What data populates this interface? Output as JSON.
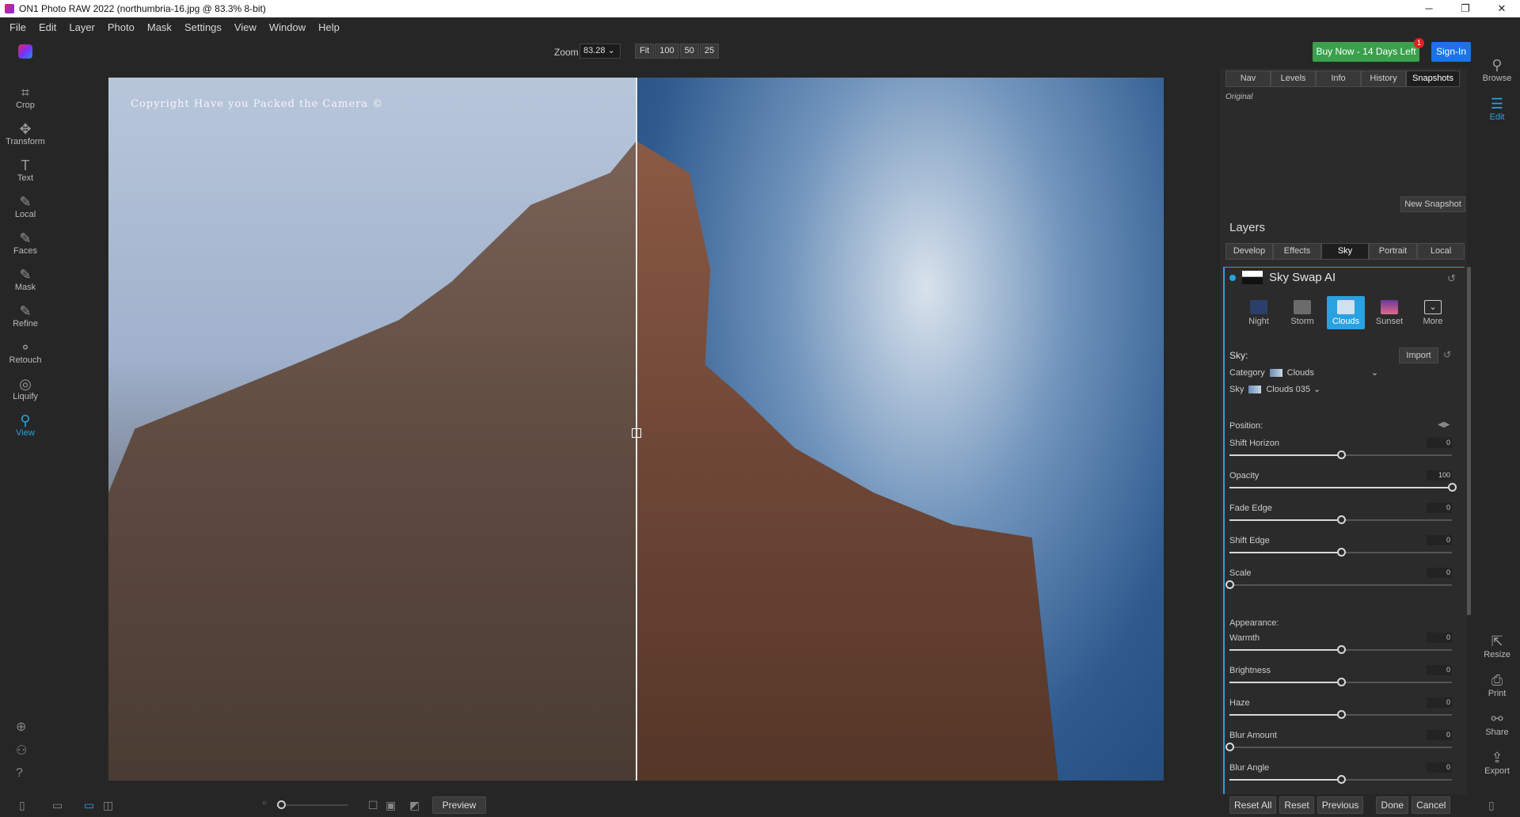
{
  "window": {
    "title": "ON1 Photo RAW 2022 (northumbria-16.jpg @ 83.3% 8-bit)",
    "controls": [
      "─",
      "❐",
      "✕"
    ]
  },
  "menu": [
    "File",
    "Edit",
    "Layer",
    "Photo",
    "Mask",
    "Settings",
    "View",
    "Window",
    "Help"
  ],
  "toolbar": {
    "zoom_label": "Zoom",
    "zoom_value": "83.28",
    "zoom_presets": [
      "Fit",
      "100",
      "50",
      "25"
    ],
    "buy_label": "Buy Now - 14 Days Left",
    "buy_badge": "1",
    "signin_label": "Sign-In"
  },
  "left_tools": [
    {
      "label": "Crop",
      "icon": "crop-icon"
    },
    {
      "label": "Transform",
      "icon": "transform-icon"
    },
    {
      "label": "Text",
      "icon": "text-icon"
    },
    {
      "label": "Local",
      "icon": "brush-icon"
    },
    {
      "label": "Faces",
      "icon": "faces-icon"
    },
    {
      "label": "Mask",
      "icon": "mask-icon"
    },
    {
      "label": "Refine",
      "icon": "refine-icon"
    },
    {
      "label": "Retouch",
      "icon": "retouch-icon"
    },
    {
      "label": "Liquify",
      "icon": "liquify-icon"
    },
    {
      "label": "View",
      "icon": "view-icon",
      "active": true
    }
  ],
  "canvas": {
    "watermark": "Copyright Have you Packed the Camera ©"
  },
  "bottom": {
    "preview_label": "Preview",
    "buttons": [
      "Reset All",
      "Reset",
      "Previous",
      "Done",
      "Cancel"
    ]
  },
  "top_tabs": [
    "Nav",
    "Levels",
    "Info",
    "History",
    "Snapshots"
  ],
  "top_tabs_active": "Snapshots",
  "snapshots": {
    "original_label": "Original",
    "new_snapshot_label": "New Snapshot"
  },
  "layers": {
    "title": "Layers",
    "tabs": [
      "Develop",
      "Effects",
      "Sky",
      "Portrait",
      "Local"
    ],
    "active_tab": "Sky"
  },
  "sky_swap": {
    "title": "Sky Swap AI",
    "presets": [
      {
        "label": "Night",
        "color": "#2b3f6a"
      },
      {
        "label": "Storm",
        "color": "#6b6b6b"
      },
      {
        "label": "Clouds",
        "color": "#9fc0e0",
        "active": true
      },
      {
        "label": "Sunset",
        "color": "#d06a8a"
      },
      {
        "label": "More",
        "color": "none"
      }
    ],
    "sky_heading": "Sky:",
    "import_label": "Import",
    "category_label": "Category",
    "category_value": "Clouds",
    "sky_label": "Sky",
    "sky_value": "Clouds 035",
    "position_heading": "Position:",
    "appearance_heading": "Appearance:",
    "sliders": [
      {
        "label": "Shift Horizon",
        "value": "0",
        "frac": 0.5
      },
      {
        "label": "Opacity",
        "value": "100",
        "frac": 1.0
      },
      {
        "label": "Fade Edge",
        "value": "0",
        "frac": 0.5
      },
      {
        "label": "Shift Edge",
        "value": "0",
        "frac": 0.5
      },
      {
        "label": "Scale",
        "value": "0",
        "frac": 0.0
      }
    ],
    "appearance_sliders": [
      {
        "label": "Warmth",
        "value": "0",
        "frac": 0.5
      },
      {
        "label": "Brightness",
        "value": "0",
        "frac": 0.5
      },
      {
        "label": "Haze",
        "value": "0",
        "frac": 0.5
      },
      {
        "label": "Blur Amount",
        "value": "0",
        "frac": 0.0
      },
      {
        "label": "Blur Angle",
        "value": "0",
        "frac": 0.5
      }
    ]
  },
  "right_rail": [
    {
      "label": "Browse",
      "icon": "browse-icon"
    },
    {
      "label": "Edit",
      "icon": "edit-icon",
      "active": true
    }
  ],
  "right_rail_bottom": [
    {
      "label": "Resize",
      "icon": "resize-icon"
    },
    {
      "label": "Print",
      "icon": "print-icon"
    },
    {
      "label": "Share",
      "icon": "share-icon"
    },
    {
      "label": "Export",
      "icon": "export-icon"
    }
  ]
}
